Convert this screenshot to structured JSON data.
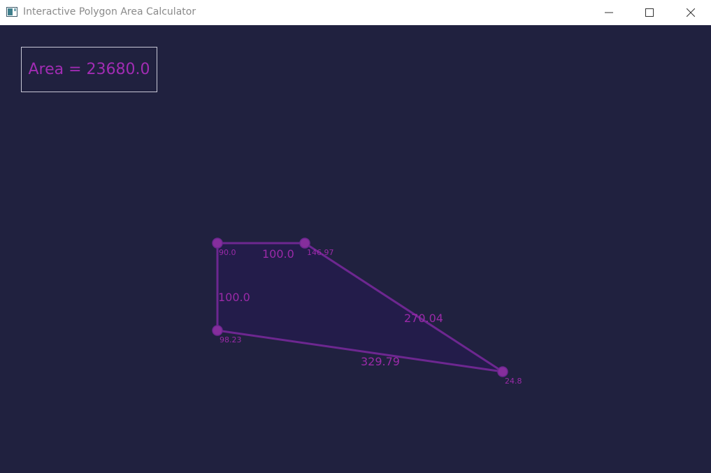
{
  "window": {
    "title": "Interactive Polygon Area Calculator",
    "icon": "app-window-icon",
    "controls": {
      "minimize_icon": "minimize-icon",
      "maximize_icon": "maximize-icon",
      "close_icon": "close-icon"
    }
  },
  "area_display": {
    "text": "Area = 23680.0"
  },
  "polygon": {
    "vertex_labels": [
      "90.0",
      "146.97",
      "24.8",
      "98.23"
    ],
    "edge_labels": [
      "100.0",
      "270.04",
      "329.79",
      "100.0"
    ]
  },
  "colors": {
    "background": "#20213f",
    "accent": "#a12cb3",
    "stroke": "#7a2a9a",
    "vertex_fill": "#8a2f9f",
    "polygon_fill": "#231c4a",
    "titlebar": "#ffffff"
  }
}
